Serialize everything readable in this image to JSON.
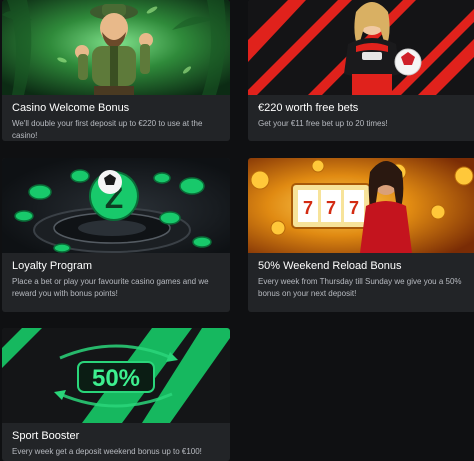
{
  "promotions": [
    {
      "title": "Casino Welcome Bonus",
      "description": "We'll double your first deposit up to €220 to use at the casino!"
    },
    {
      "title": "€220 worth free bets",
      "description": "Get your €11 free bet up to 20 times!"
    },
    {
      "title": "Loyalty Program",
      "description": "Place a bet or play your favourite casino games and we reward you with bonus points!"
    },
    {
      "title": "50% Weekend Reload Bonus",
      "description": "Every week from Thursday till Sunday we give you a 50% bonus on your next deposit!"
    },
    {
      "title": "Sport Booster",
      "description": "Every week get a deposit weekend bonus up to €100!",
      "badge": "50%"
    }
  ],
  "colors": {
    "page_bg": "#0f1012",
    "card_bg": "#222427",
    "accent_green": "#18c96b",
    "accent_red": "#e0221c",
    "gold": "#f2a81d"
  }
}
